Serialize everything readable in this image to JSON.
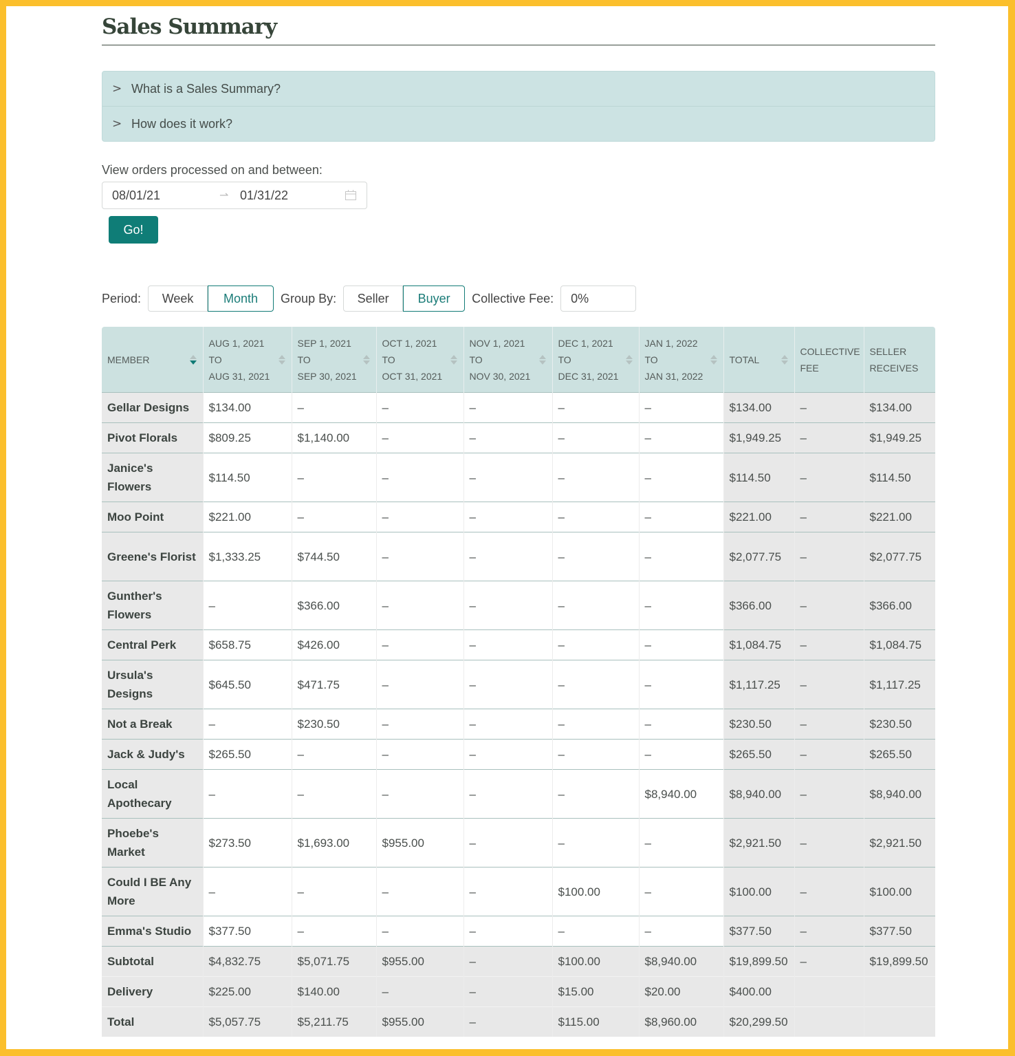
{
  "page": {
    "title": "Sales Summary"
  },
  "accordion": [
    {
      "label": "What is a Sales Summary?",
      "icon": "chevron-right-icon"
    },
    {
      "label": "How does it work?",
      "icon": "chevron-right-icon"
    }
  ],
  "date_filter": {
    "label": "View orders processed on and between:",
    "start": "08/01/21",
    "end": "01/31/22",
    "arrow": "→",
    "icon": "calendar-icon",
    "go_label": "Go!"
  },
  "controls": {
    "period_label": "Period:",
    "period_options": [
      "Week",
      "Month"
    ],
    "period_selected": "Month",
    "group_label": "Group By:",
    "group_options": [
      "Seller",
      "Buyer"
    ],
    "group_selected": "Buyer",
    "fee_label": "Collective Fee:",
    "fee_value": "0%"
  },
  "colors": {
    "accent": "#0f7d77",
    "header_bg": "#cce1e0",
    "frame": "#fbbf2c"
  },
  "table": {
    "columns": [
      {
        "lines": [
          "MEMBER"
        ],
        "sortable": true,
        "sort": "desc"
      },
      {
        "lines": [
          "AUG 1, 2021",
          "TO",
          "AUG 31, 2021"
        ],
        "sortable": true
      },
      {
        "lines": [
          "SEP 1, 2021",
          "TO",
          "SEP 30, 2021"
        ],
        "sortable": true
      },
      {
        "lines": [
          "OCT 1, 2021",
          "TO",
          "OCT 31, 2021"
        ],
        "sortable": true
      },
      {
        "lines": [
          "NOV 1, 2021",
          "TO",
          "NOV 30, 2021"
        ],
        "sortable": true
      },
      {
        "lines": [
          "DEC 1, 2021",
          "TO",
          "DEC 31, 2021"
        ],
        "sortable": true
      },
      {
        "lines": [
          "JAN 1, 2022",
          "TO",
          "JAN 31, 2022"
        ],
        "sortable": true
      },
      {
        "lines": [
          "TOTAL"
        ],
        "sortable": true
      },
      {
        "lines": [
          "COLLECTIVE",
          "FEE"
        ],
        "sortable": false
      },
      {
        "lines": [
          "SELLER",
          "RECEIVES"
        ],
        "sortable": false
      }
    ],
    "rows": [
      {
        "member": "Gellar Designs",
        "cells": [
          "$134.00",
          "–",
          "–",
          "–",
          "–",
          "–",
          "$134.00",
          "–",
          "$134.00"
        ]
      },
      {
        "member": "Pivot Florals",
        "cells": [
          "$809.25",
          "$1,140.00",
          "–",
          "–",
          "–",
          "–",
          "$1,949.25",
          "–",
          "$1,949.25"
        ]
      },
      {
        "member": "Janice's Flowers",
        "cells": [
          "$114.50",
          "–",
          "–",
          "–",
          "–",
          "–",
          "$114.50",
          "–",
          "$114.50"
        ]
      },
      {
        "member": "Moo Point",
        "cells": [
          "$221.00",
          "–",
          "–",
          "–",
          "–",
          "–",
          "$221.00",
          "–",
          "$221.00"
        ]
      },
      {
        "member": "Greene's Florist",
        "cells": [
          "$1,333.25",
          "$744.50",
          "–",
          "–",
          "–",
          "–",
          "$2,077.75",
          "–",
          "$2,077.75"
        ]
      },
      {
        "member": "Gunther's Flowers",
        "cells": [
          "–",
          "$366.00",
          "–",
          "–",
          "–",
          "–",
          "$366.00",
          "–",
          "$366.00"
        ]
      },
      {
        "member": "Central Perk",
        "cells": [
          "$658.75",
          "$426.00",
          "–",
          "–",
          "–",
          "–",
          "$1,084.75",
          "–",
          "$1,084.75"
        ]
      },
      {
        "member": "Ursula's Designs",
        "cells": [
          "$645.50",
          "$471.75",
          "–",
          "–",
          "–",
          "–",
          "$1,117.25",
          "–",
          "$1,117.25"
        ]
      },
      {
        "member": "Not a Break",
        "cells": [
          "–",
          "$230.50",
          "–",
          "–",
          "–",
          "–",
          "$230.50",
          "–",
          "$230.50"
        ]
      },
      {
        "member": "Jack & Judy's",
        "cells": [
          "$265.50",
          "–",
          "–",
          "–",
          "–",
          "–",
          "$265.50",
          "–",
          "$265.50"
        ]
      },
      {
        "member": "Local Apothecary",
        "cells": [
          "–",
          "–",
          "–",
          "–",
          "–",
          "$8,940.00",
          "$8,940.00",
          "–",
          "$8,940.00"
        ]
      },
      {
        "member": "Phoebe's Market",
        "cells": [
          "$273.50",
          "$1,693.00",
          "$955.00",
          "–",
          "–",
          "–",
          "$2,921.50",
          "–",
          "$2,921.50"
        ]
      },
      {
        "member": "Could I BE Any More",
        "cells": [
          "–",
          "–",
          "–",
          "–",
          "$100.00",
          "–",
          "$100.00",
          "–",
          "$100.00"
        ]
      },
      {
        "member": "Emma's Studio",
        "cells": [
          "$377.50",
          "–",
          "–",
          "–",
          "–",
          "–",
          "$377.50",
          "–",
          "$377.50"
        ]
      }
    ],
    "footer": [
      {
        "label": "Subtotal",
        "cells": [
          "$4,832.75",
          "$5,071.75",
          "$955.00",
          "–",
          "$100.00",
          "$8,940.00",
          "$19,899.50",
          "–",
          "$19,899.50"
        ]
      },
      {
        "label": "Delivery",
        "cells": [
          "$225.00",
          "$140.00",
          "–",
          "–",
          "$15.00",
          "$20.00",
          "$400.00",
          "",
          ""
        ]
      },
      {
        "label": "Total",
        "cells": [
          "$5,057.75",
          "$5,211.75",
          "$955.00",
          "–",
          "$115.00",
          "$8,960.00",
          "$20,299.50",
          "",
          ""
        ]
      }
    ]
  }
}
